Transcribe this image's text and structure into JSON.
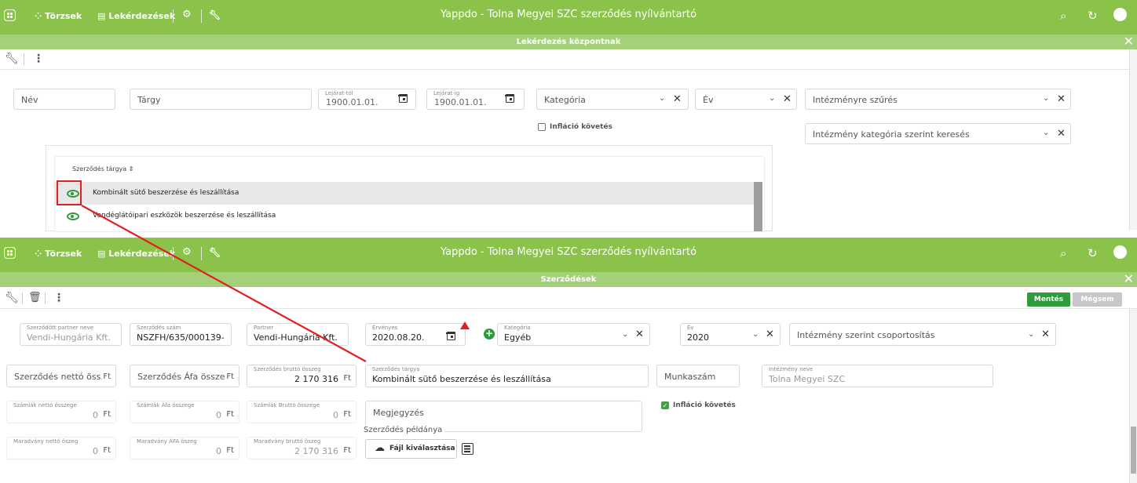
{
  "app": {
    "title": "Yappdo - Tolna Megyei SZC szerződés nyílvántartó",
    "nav_torzsek": "Törzsek",
    "nav_lekerdezesek": "Lekérdezések"
  },
  "top": {
    "subtitle": "Lekérdezés központnak",
    "filters": {
      "nev": "Név",
      "targy": "Tárgy",
      "lejarat_tol_label": "Lejárat-tól",
      "lejarat_tol_value": "1900.01.01.",
      "lejarat_ig_label": "Lejárat-ig",
      "lejarat_ig_value": "1900.01.01.",
      "kategoria": "Kategória",
      "ev": "Év",
      "intezmeny_szures": "Intézményre szűrés",
      "intezmeny_kategoria": "Intézmény kategória szerint keresés",
      "inflacio": "Infláció követés"
    },
    "table": {
      "header": "Szerződés tárgya",
      "rows": [
        "Kombinált sütő beszerzése és leszállítása",
        "Vendéglátóipari eszközök beszerzése és leszállítása"
      ]
    }
  },
  "bottom": {
    "subtitle": "Szerződések",
    "buttons": {
      "save": "Mentés",
      "cancel": "Mégsem"
    },
    "fields": {
      "partner_neve_label": "Szerződött partner neve",
      "partner_neve_value": "Vendi-Hungária Kft.",
      "szam_label": "Szerződés szám",
      "szam_value": "NSZFH/635/000139-",
      "partner_label": "Partner",
      "partner_value": "Vendi-Hungária Kft.",
      "ervenyes_label": "Érvényes",
      "ervenyes_value": "2020.08.20.",
      "kategoria_label": "Kategória",
      "kategoria_value": "Egyéb",
      "ev_label": "Év",
      "ev_value": "2020",
      "csoportositas": "Intézmény szerint csoportosítás",
      "netto": "Szerződés nettó öss...",
      "afa": "Szerződés Áfa összeg",
      "brutto_label": "Szerződés bruttó összeg",
      "brutto_value": "2 170 316",
      "targy_label": "Szerződés tárgya",
      "targy_value": "Kombinált sütő beszerzése és leszállítása",
      "munkaszam": "Munkaszám",
      "intezmeny_label": "Intézmény neve",
      "intezmeny_value": "Tolna Megyei SZC",
      "szamlak_netto_label": "Számlák nettó összege",
      "szamlak_netto_value": "0",
      "szamlak_afa_label": "Számlák Áfa összege",
      "szamlak_afa_value": "0",
      "szamlak_brutto_label": "Számlák Bruttó összege",
      "szamlak_brutto_value": "0",
      "megjegyzes": "Megjegyzés",
      "inflacio": "Infláció követés",
      "maradvany_netto_label": "Maradvány nettó öszeg",
      "maradvany_netto_value": "0",
      "maradvany_afa_label": "Maradvány ÁFA öszeg",
      "maradvany_afa_value": "0",
      "maradvany_brutto_label": "Maradvány bruttó öszeg",
      "maradvany_brutto_value": "2 170 316",
      "peldany_label": "Szerződés példánya",
      "fajl_button": "Fájl kiválasztása",
      "currency": "Ft"
    }
  },
  "colors": {
    "topbar": "#8bc34a",
    "subbar": "#a5d07a",
    "accent_green": "#43a047",
    "annotation_red": "#e02020"
  }
}
